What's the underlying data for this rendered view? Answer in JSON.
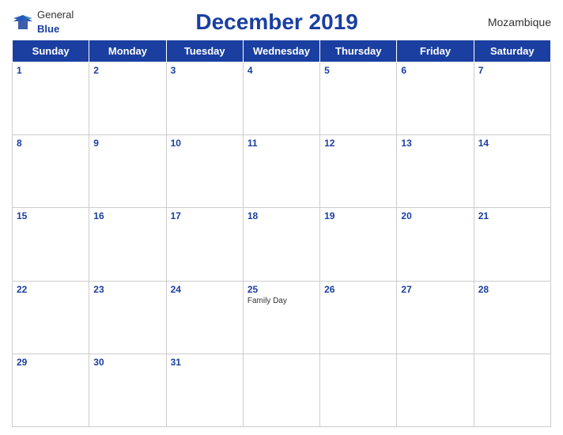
{
  "header": {
    "logo_general": "General",
    "logo_blue": "Blue",
    "title": "December 2019",
    "country": "Mozambique"
  },
  "columns": [
    "Sunday",
    "Monday",
    "Tuesday",
    "Wednesday",
    "Thursday",
    "Friday",
    "Saturday"
  ],
  "weeks": [
    [
      {
        "day": "1",
        "event": ""
      },
      {
        "day": "2",
        "event": ""
      },
      {
        "day": "3",
        "event": ""
      },
      {
        "day": "4",
        "event": ""
      },
      {
        "day": "5",
        "event": ""
      },
      {
        "day": "6",
        "event": ""
      },
      {
        "day": "7",
        "event": ""
      }
    ],
    [
      {
        "day": "8",
        "event": ""
      },
      {
        "day": "9",
        "event": ""
      },
      {
        "day": "10",
        "event": ""
      },
      {
        "day": "11",
        "event": ""
      },
      {
        "day": "12",
        "event": ""
      },
      {
        "day": "13",
        "event": ""
      },
      {
        "day": "14",
        "event": ""
      }
    ],
    [
      {
        "day": "15",
        "event": ""
      },
      {
        "day": "16",
        "event": ""
      },
      {
        "day": "17",
        "event": ""
      },
      {
        "day": "18",
        "event": ""
      },
      {
        "day": "19",
        "event": ""
      },
      {
        "day": "20",
        "event": ""
      },
      {
        "day": "21",
        "event": ""
      }
    ],
    [
      {
        "day": "22",
        "event": ""
      },
      {
        "day": "23",
        "event": ""
      },
      {
        "day": "24",
        "event": ""
      },
      {
        "day": "25",
        "event": "Family Day"
      },
      {
        "day": "26",
        "event": ""
      },
      {
        "day": "27",
        "event": ""
      },
      {
        "day": "28",
        "event": ""
      }
    ],
    [
      {
        "day": "29",
        "event": ""
      },
      {
        "day": "30",
        "event": ""
      },
      {
        "day": "31",
        "event": ""
      },
      {
        "day": "",
        "event": ""
      },
      {
        "day": "",
        "event": ""
      },
      {
        "day": "",
        "event": ""
      },
      {
        "day": "",
        "event": ""
      }
    ]
  ]
}
